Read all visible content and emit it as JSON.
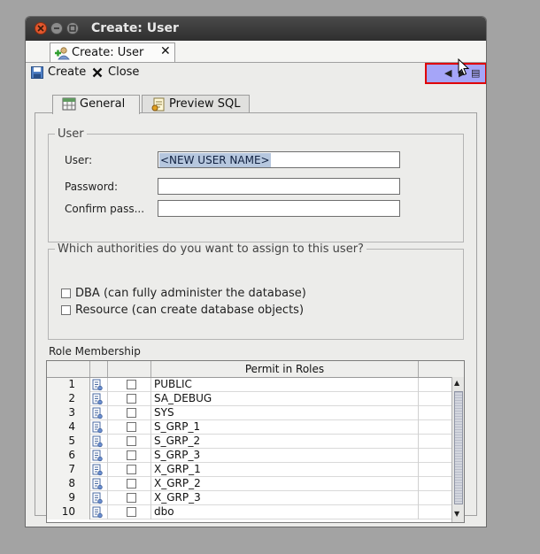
{
  "window": {
    "title": "Create: User"
  },
  "editor_tab": {
    "label": "Create: User",
    "close_glyph": "✕"
  },
  "nav": {
    "prev_glyph": "◀",
    "next_glyph": "▶",
    "menu_glyph": "▤"
  },
  "toolbar": {
    "create_label": "Create",
    "close_label": "Close"
  },
  "form_tabs": [
    {
      "label": "General",
      "icon": "table-icon",
      "active": true
    },
    {
      "label": "Preview SQL",
      "icon": "sql-script-icon",
      "active": false
    }
  ],
  "user_group": {
    "legend": "User",
    "user_label": "User:",
    "user_value": "<NEW USER NAME>",
    "password_label": "Password:",
    "password_value": "",
    "confirm_label": "Confirm pass...",
    "confirm_value": ""
  },
  "authorities_group": {
    "legend": "Which authorities do you want to assign to this user?",
    "dba_label": "DBA (can fully administer the database)",
    "resource_label": "Resource (can create database objects)"
  },
  "roles": {
    "caption": "Role Membership",
    "column_header": "Permit in Roles",
    "rows": [
      {
        "num": "1",
        "name": "PUBLIC"
      },
      {
        "num": "2",
        "name": "SA_DEBUG"
      },
      {
        "num": "3",
        "name": "SYS"
      },
      {
        "num": "4",
        "name": "S_GRP_1"
      },
      {
        "num": "5",
        "name": "S_GRP_2"
      },
      {
        "num": "6",
        "name": "S_GRP_3"
      },
      {
        "num": "7",
        "name": "X_GRP_1"
      },
      {
        "num": "8",
        "name": "X_GRP_2"
      },
      {
        "num": "9",
        "name": "X_GRP_3"
      },
      {
        "num": "10",
        "name": "dbo"
      }
    ]
  },
  "colors": {
    "accent_highlight": "#a5a5f8",
    "focus_border": "#e00000",
    "selection": "#b6c7de"
  }
}
